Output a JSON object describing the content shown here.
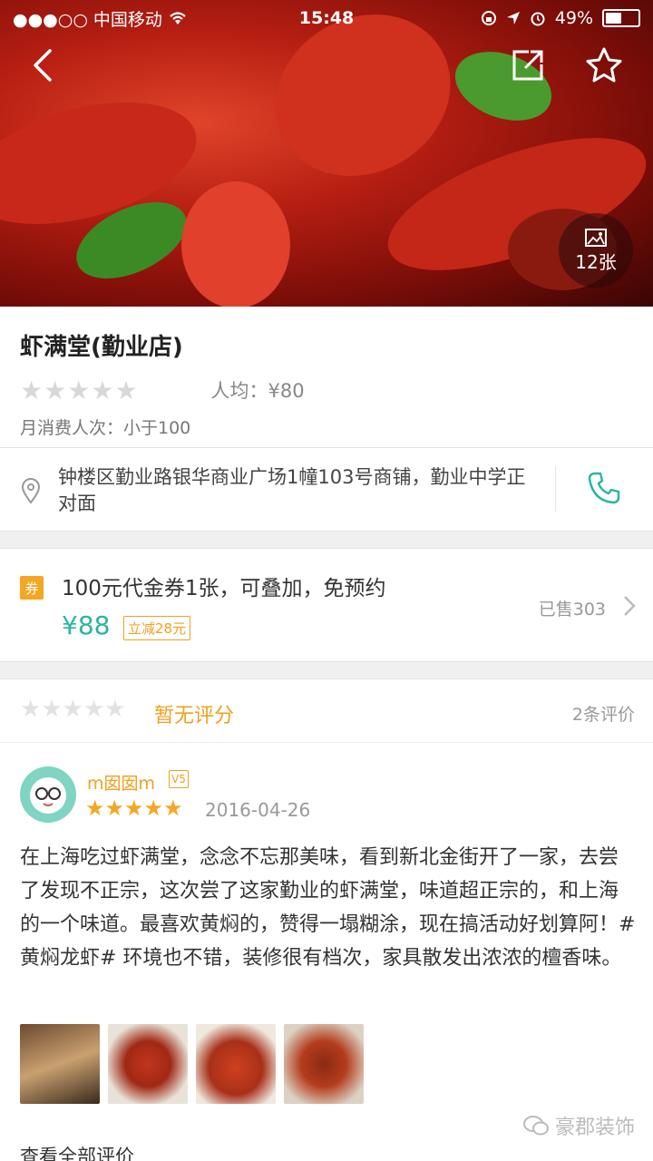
{
  "status_bar": {
    "carrier": "●●●○○ 中国移动",
    "time": "15:48",
    "battery": "49%",
    "battery_level": 0.49
  },
  "hero": {
    "photo_count": "12张",
    "icons": [
      "back-arrow-icon",
      "share-icon",
      "star-outline-icon",
      "image-icon"
    ]
  },
  "shop": {
    "name": "虾满堂(勤业店)",
    "rating_stars": 0,
    "avg_price": "人均：¥80",
    "monthly": "月消费人次：小于100"
  },
  "address": {
    "text": "钟楼区勤业路银华商业广场1幢103号商铺，勤业中学正对面"
  },
  "deal": {
    "badge": "券",
    "title": "100元代金券1张，可叠加，免预约",
    "price": "¥88",
    "discount": "立减28元",
    "sold": "已售303"
  },
  "reviews": {
    "summary": "暂无评分",
    "count": "2条评价",
    "item": {
      "user": "m囡囡m",
      "vip_badge": "V5",
      "stars": 5,
      "date": "2016-04-26",
      "text": "在上海吃过虾满堂，念念不忘那美味，看到新北金街开了一家，去尝了发现不正宗，这次尝了这家勤业的虾满堂，味道超正宗的，和上海的一个味道。最喜欢黄焖的，赞得一塌糊涂，现在搞活动好划算阿！#黄焖龙虾# 环境也不错，装修很有档次，家具散发出浓浓的檀香味。"
    },
    "more_label": "查看全部评价"
  },
  "watermark": "豪郡装饰",
  "colors": {
    "accent_green": "#2bb59f",
    "accent_orange": "#f0a020",
    "star_gold": "#f5a623"
  }
}
